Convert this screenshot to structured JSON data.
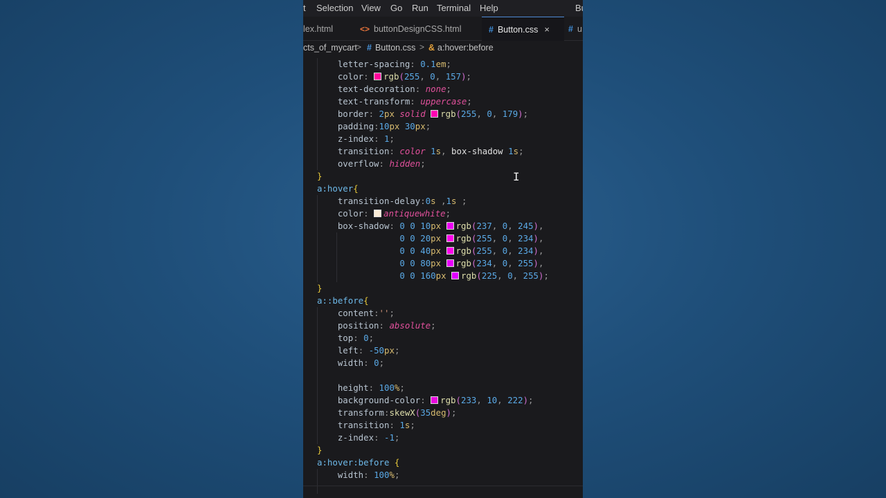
{
  "menu": [
    "t",
    "Selection",
    "View",
    "Go",
    "Run",
    "Terminal",
    "Help",
    "Bu"
  ],
  "tabs": [
    {
      "label": "lex.html",
      "icon": "none",
      "active": false
    },
    {
      "label": "buttonDesignCSS.html",
      "icon": "html-icon",
      "active": false
    },
    {
      "label": "Button.css",
      "icon": "css-icon",
      "active": true,
      "close": "×"
    },
    {
      "label": "u",
      "icon": "css-icon",
      "active": false
    }
  ],
  "breadcrumb": {
    "folder": "cts_of_mycart",
    "file": "Button.css",
    "symbol": "a:hover:before"
  },
  "icons": {
    "html": "<>",
    "css": "#",
    "symbol": "&",
    "separator": ">"
  },
  "colors": {
    "accent": "#4f8bd6",
    "swatch_1": "#ff009d",
    "swatch_2": "#ff00b3",
    "swatch_3": "#faebd7",
    "swatch_4": "#ed00f5",
    "swatch_5": "#ff00ea",
    "swatch_6": "#ea00ff",
    "swatch_7": "#e100ff",
    "swatch_8": "#e90ade"
  },
  "code_lines": [
    "    letter-spacing: 0.1em;",
    "    color: rgb(255, 0, 157);",
    "    text-decoration: none;",
    "    text-transform: uppercase;",
    "    border: 2px solid rgb(255, 0, 179);",
    "    padding:10px 30px;",
    "    z-index: 1;",
    "    transition: color 1s, box-shadow 1s;",
    "    overflow: hidden;",
    "}",
    "a:hover{",
    "    transition-delay:0s ,1s ;",
    "    color: antiquewhite;",
    "    box-shadow: 0 0 10px rgb(237, 0, 245),",
    "                0 0 20px rgb(255, 0, 234),",
    "                0 0 40px rgb(255, 0, 234),",
    "                0 0 80px rgb(234, 0, 255),",
    "                0 0 160px rgb(225, 0, 255);",
    "}",
    "a::before{",
    "    content:'';",
    "    position: absolute;",
    "    top: 0;",
    "    left: -50px;",
    "    width: 0;",
    "",
    "    height: 100%;",
    "    background-color: rgb(233, 10, 222);",
    "    transform:skewX(35deg);",
    "    transition: 1s;",
    "    z-index: -1;",
    "}",
    "a:hover:before {",
    "    width: 100%;"
  ],
  "cursor_glyph": "I"
}
